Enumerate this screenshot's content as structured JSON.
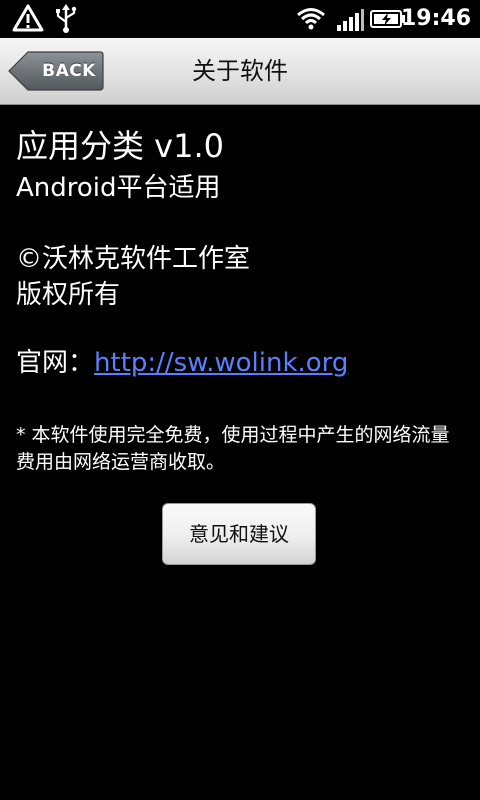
{
  "status_bar": {
    "time": "19:46",
    "icons": [
      "warning-icon",
      "usb-icon",
      "wifi-icon",
      "signal-icon",
      "battery-charging-icon"
    ]
  },
  "title_bar": {
    "back_label": "BACK",
    "title": "关于软件"
  },
  "about": {
    "app_name": "应用分类 v1.0",
    "platform": "Android平台适用",
    "copyright": "©沃林克软件工作室",
    "rights": "版权所有",
    "website_label": "官网：",
    "website_url": "http://sw.wolink.org",
    "notice": "* 本软件使用完全免费，使用过程中产生的网络流量费用由网络运营商收取。"
  },
  "feedback_button": {
    "label": "意见和建议"
  },
  "colors": {
    "background": "#000000",
    "link": "#5a7fff",
    "title_bar": "#e4e4e4",
    "back_button": "#6f7478"
  }
}
